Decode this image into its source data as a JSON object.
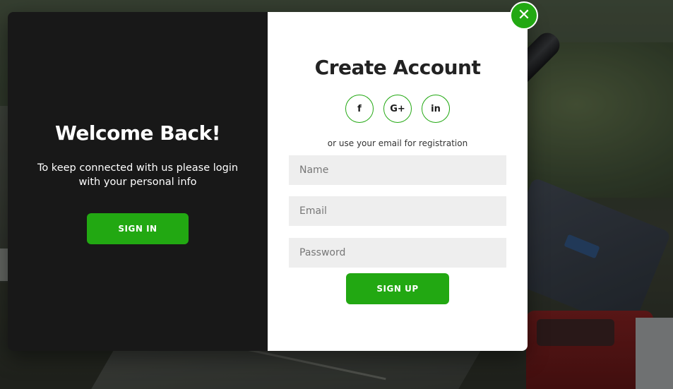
{
  "close": {
    "symbol": "✕"
  },
  "left_panel": {
    "title": "Welcome Back!",
    "message": "To keep connected with us please login with your personal info",
    "signin_label": "SIGN IN"
  },
  "right_panel": {
    "title": "Create Account",
    "socials": [
      {
        "icon": "facebook-icon",
        "glyph": "f"
      },
      {
        "icon": "google-plus-icon",
        "glyph": "G+"
      },
      {
        "icon": "linkedin-icon",
        "glyph": "in"
      }
    ],
    "hint": "or use your email for registration",
    "fields": {
      "name_placeholder": "Name",
      "email_placeholder": "Email",
      "password_placeholder": "Password"
    },
    "signup_label": "SIGN UP"
  },
  "colors": {
    "accent": "#22a812",
    "left_panel_bg": "#181818",
    "input_bg": "#eeeeee"
  }
}
